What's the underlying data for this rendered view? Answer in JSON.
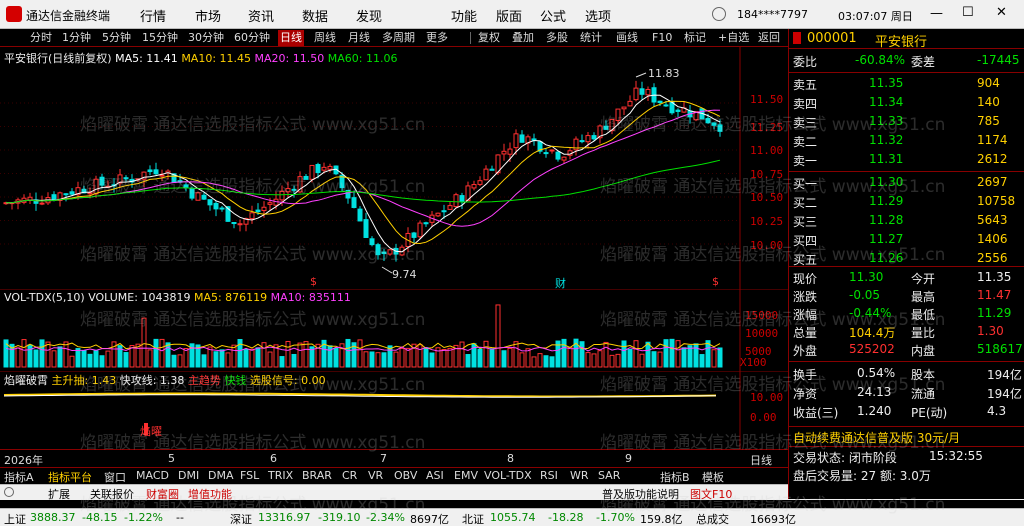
{
  "titlebar": {
    "app_title": "通达信金融终端",
    "menus": [
      "行情",
      "市场",
      "资讯",
      "数据",
      "发现",
      "功能",
      "版面",
      "公式",
      "选项"
    ],
    "account": "184****7797",
    "time": "03:07:07 周日"
  },
  "toolbar": {
    "periods": [
      "分时",
      "1分钟",
      "5分钟",
      "15分钟",
      "30分钟",
      "60分钟",
      "日线",
      "周线",
      "月线",
      "多周期",
      "更多"
    ],
    "active_period": "日线",
    "actions": [
      "复权",
      "叠加",
      "多股",
      "统计",
      "画线",
      "F10",
      "标记",
      "+自选",
      "返回"
    ]
  },
  "main_chart": {
    "legend_prefix": "平安银行(日线前复权)",
    "legend_items": [
      {
        "label": "MA5: 11.41",
        "color": "#ffffff"
      },
      {
        "label": "MA10: 11.45",
        "color": "#ffd000"
      },
      {
        "label": "MA20: 11.50",
        "color": "#ff40ff"
      },
      {
        "label": "MA60: 11.06",
        "color": "#00e000"
      }
    ],
    "price_labels": [
      "11.50",
      "11.25",
      "11.00",
      "10.75",
      "10.50",
      "10.25",
      "10.00"
    ],
    "high_label": "11.83",
    "low_label": "9.74",
    "markers": [
      "$",
      "财",
      "$"
    ]
  },
  "vol_chart": {
    "legend": [
      "VOL-TDX(5,10)",
      "VOLUME: 1043819",
      "MA5: 876119",
      "MA10: 835111"
    ],
    "axis_labels": [
      "15000",
      "10000",
      "5000",
      "X100"
    ]
  },
  "ind_chart": {
    "legend": [
      "焰曜破霄",
      "主升抽: 1.43",
      "快攻线: 1.38",
      "主趋势",
      "快钱",
      "选股信号: 0.00"
    ],
    "axis_labels": [
      "10.00",
      "0.00"
    ],
    "signal_label": "焰曜"
  },
  "x_axis": {
    "year": "2026年",
    "months": [
      "5",
      "6",
      "7",
      "8",
      "9"
    ],
    "period": "日线"
  },
  "bottom_tabs": [
    "指标A",
    "指标平台",
    "窗口",
    "MACD",
    "DMI",
    "DMA",
    "FSL",
    "TRIX",
    "BRAR",
    "CR",
    "VR",
    "OBV",
    "ASI",
    "EMV",
    "VOL-TDX",
    "RSI",
    "WR",
    "SAR",
    "指标B",
    "模板"
  ],
  "bottom_tabs_active": "指标平台",
  "sub_strip": [
    "扩展",
    "关联报价",
    "财富圈",
    "增值功能"
  ],
  "quote": {
    "code": "000001",
    "name": "平安银行",
    "weibi": {
      "label": "委比",
      "value": "-60.84%",
      "label2": "委差",
      "value2": "-17445"
    },
    "asks": [
      {
        "label": "卖五",
        "price": "11.35",
        "vol": "904"
      },
      {
        "label": "卖四",
        "price": "11.34",
        "vol": "140"
      },
      {
        "label": "卖三",
        "price": "11.33",
        "vol": "785"
      },
      {
        "label": "卖二",
        "price": "11.32",
        "vol": "1174"
      },
      {
        "label": "卖一",
        "price": "11.31",
        "vol": "2612"
      }
    ],
    "bids": [
      {
        "label": "买一",
        "price": "11.30",
        "vol": "2697"
      },
      {
        "label": "买二",
        "price": "11.29",
        "vol": "10758"
      },
      {
        "label": "买三",
        "price": "11.28",
        "vol": "5643"
      },
      {
        "label": "买四",
        "price": "11.27",
        "vol": "1406"
      },
      {
        "label": "买五",
        "price": "11.26",
        "vol": "2556"
      }
    ],
    "stats": [
      {
        "l1": "现价",
        "v1": "11.30",
        "l2": "今开",
        "v2": "11.35"
      },
      {
        "l1": "涨跌",
        "v1": "-0.05",
        "l2": "最高",
        "v2": "11.47"
      },
      {
        "l1": "涨幅",
        "v1": "-0.44%",
        "l2": "最低",
        "v2": "11.29"
      },
      {
        "l1": "总量",
        "v1": "104.4万",
        "l2": "量比",
        "v2": "1.30"
      },
      {
        "l1": "外盘",
        "v1": "525202",
        "l2": "内盘",
        "v2": "518617"
      }
    ],
    "stats2": [
      {
        "l1": "换手",
        "v1": "0.54%",
        "l2": "股本",
        "v2": "194亿"
      },
      {
        "l1": "净资",
        "v1": "24.13",
        "l2": "流通",
        "v2": "194亿"
      },
      {
        "l1": "收益(三)",
        "v1": "1.240",
        "l2": "PE(动)",
        "v2": "4.3"
      }
    ],
    "promo": "自动续费通达信普及版 30元/月",
    "trade_status_label": "交易状态: 闭市阶段",
    "trade_time": "15:32:55",
    "after_hours": "盘后交易量: 27   额: 3.0万",
    "footer_right": "普及版功能说明",
    "footer_f10": "图文F10",
    "footer_tabs": [
      "笔",
      "价",
      "细",
      "势",
      "联",
      "主",
      "逆"
    ]
  },
  "status": {
    "sh_label": "上证",
    "sh_value": "3888.37",
    "sh_change": "-48.15",
    "sh_pct": "-1.22%",
    "sh_amount": "--",
    "sz_label": "深证",
    "sz_value": "13316.97",
    "sz_change": "-319.10",
    "sz_pct": "-2.34%",
    "sz_amount": "8697亿",
    "bz_label": "北证",
    "bz_value": "1055.74",
    "bz_change": "-18.28",
    "bz_pct": "-1.70%",
    "bz_amount": "159.8亿",
    "total_label": "总成交",
    "total_value": "16693亿"
  },
  "watermark": "焰曜破霄 通达信选股指标公式 www.xg51.cn"
}
